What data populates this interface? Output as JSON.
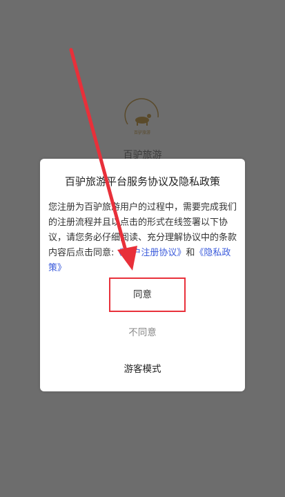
{
  "app": {
    "name": "百驴旅游",
    "logo_text": "百驴旅游",
    "logo_icon": "donkey-logo-icon"
  },
  "dialog": {
    "title": "百驴旅游平台服务协议及隐私政策",
    "body_text": "您注册为百驴旅游用户的过程中，需要完成我们的注册流程并且以点击的形式在线签署以下协议，请您务必仔细阅读、充分理解协议中的条款内容后点击同意:",
    "link_user_agreement": "《用户注册协议》",
    "and_text": "和",
    "link_privacy_policy": "《隐私政策》",
    "agree_label": "同意",
    "disagree_label": "不同意",
    "guest_label": "游客模式"
  },
  "annotation": {
    "highlight_color": "#e8303a"
  }
}
